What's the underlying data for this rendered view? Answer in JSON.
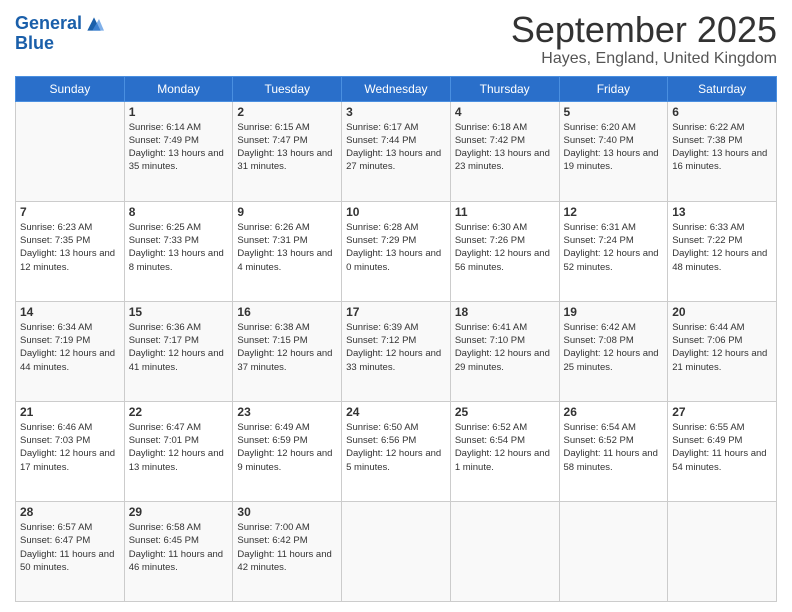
{
  "header": {
    "logo_line1": "General",
    "logo_line2": "Blue",
    "month_title": "September 2025",
    "location": "Hayes, England, United Kingdom"
  },
  "weekdays": [
    "Sunday",
    "Monday",
    "Tuesday",
    "Wednesday",
    "Thursday",
    "Friday",
    "Saturday"
  ],
  "weeks": [
    [
      {
        "day": "",
        "sunrise": "",
        "sunset": "",
        "daylight": ""
      },
      {
        "day": "1",
        "sunrise": "Sunrise: 6:14 AM",
        "sunset": "Sunset: 7:49 PM",
        "daylight": "Daylight: 13 hours and 35 minutes."
      },
      {
        "day": "2",
        "sunrise": "Sunrise: 6:15 AM",
        "sunset": "Sunset: 7:47 PM",
        "daylight": "Daylight: 13 hours and 31 minutes."
      },
      {
        "day": "3",
        "sunrise": "Sunrise: 6:17 AM",
        "sunset": "Sunset: 7:44 PM",
        "daylight": "Daylight: 13 hours and 27 minutes."
      },
      {
        "day": "4",
        "sunrise": "Sunrise: 6:18 AM",
        "sunset": "Sunset: 7:42 PM",
        "daylight": "Daylight: 13 hours and 23 minutes."
      },
      {
        "day": "5",
        "sunrise": "Sunrise: 6:20 AM",
        "sunset": "Sunset: 7:40 PM",
        "daylight": "Daylight: 13 hours and 19 minutes."
      },
      {
        "day": "6",
        "sunrise": "Sunrise: 6:22 AM",
        "sunset": "Sunset: 7:38 PM",
        "daylight": "Daylight: 13 hours and 16 minutes."
      }
    ],
    [
      {
        "day": "7",
        "sunrise": "Sunrise: 6:23 AM",
        "sunset": "Sunset: 7:35 PM",
        "daylight": "Daylight: 13 hours and 12 minutes."
      },
      {
        "day": "8",
        "sunrise": "Sunrise: 6:25 AM",
        "sunset": "Sunset: 7:33 PM",
        "daylight": "Daylight: 13 hours and 8 minutes."
      },
      {
        "day": "9",
        "sunrise": "Sunrise: 6:26 AM",
        "sunset": "Sunset: 7:31 PM",
        "daylight": "Daylight: 13 hours and 4 minutes."
      },
      {
        "day": "10",
        "sunrise": "Sunrise: 6:28 AM",
        "sunset": "Sunset: 7:29 PM",
        "daylight": "Daylight: 13 hours and 0 minutes."
      },
      {
        "day": "11",
        "sunrise": "Sunrise: 6:30 AM",
        "sunset": "Sunset: 7:26 PM",
        "daylight": "Daylight: 12 hours and 56 minutes."
      },
      {
        "day": "12",
        "sunrise": "Sunrise: 6:31 AM",
        "sunset": "Sunset: 7:24 PM",
        "daylight": "Daylight: 12 hours and 52 minutes."
      },
      {
        "day": "13",
        "sunrise": "Sunrise: 6:33 AM",
        "sunset": "Sunset: 7:22 PM",
        "daylight": "Daylight: 12 hours and 48 minutes."
      }
    ],
    [
      {
        "day": "14",
        "sunrise": "Sunrise: 6:34 AM",
        "sunset": "Sunset: 7:19 PM",
        "daylight": "Daylight: 12 hours and 44 minutes."
      },
      {
        "day": "15",
        "sunrise": "Sunrise: 6:36 AM",
        "sunset": "Sunset: 7:17 PM",
        "daylight": "Daylight: 12 hours and 41 minutes."
      },
      {
        "day": "16",
        "sunrise": "Sunrise: 6:38 AM",
        "sunset": "Sunset: 7:15 PM",
        "daylight": "Daylight: 12 hours and 37 minutes."
      },
      {
        "day": "17",
        "sunrise": "Sunrise: 6:39 AM",
        "sunset": "Sunset: 7:12 PM",
        "daylight": "Daylight: 12 hours and 33 minutes."
      },
      {
        "day": "18",
        "sunrise": "Sunrise: 6:41 AM",
        "sunset": "Sunset: 7:10 PM",
        "daylight": "Daylight: 12 hours and 29 minutes."
      },
      {
        "day": "19",
        "sunrise": "Sunrise: 6:42 AM",
        "sunset": "Sunset: 7:08 PM",
        "daylight": "Daylight: 12 hours and 25 minutes."
      },
      {
        "day": "20",
        "sunrise": "Sunrise: 6:44 AM",
        "sunset": "Sunset: 7:06 PM",
        "daylight": "Daylight: 12 hours and 21 minutes."
      }
    ],
    [
      {
        "day": "21",
        "sunrise": "Sunrise: 6:46 AM",
        "sunset": "Sunset: 7:03 PM",
        "daylight": "Daylight: 12 hours and 17 minutes."
      },
      {
        "day": "22",
        "sunrise": "Sunrise: 6:47 AM",
        "sunset": "Sunset: 7:01 PM",
        "daylight": "Daylight: 12 hours and 13 minutes."
      },
      {
        "day": "23",
        "sunrise": "Sunrise: 6:49 AM",
        "sunset": "Sunset: 6:59 PM",
        "daylight": "Daylight: 12 hours and 9 minutes."
      },
      {
        "day": "24",
        "sunrise": "Sunrise: 6:50 AM",
        "sunset": "Sunset: 6:56 PM",
        "daylight": "Daylight: 12 hours and 5 minutes."
      },
      {
        "day": "25",
        "sunrise": "Sunrise: 6:52 AM",
        "sunset": "Sunset: 6:54 PM",
        "daylight": "Daylight: 12 hours and 1 minute."
      },
      {
        "day": "26",
        "sunrise": "Sunrise: 6:54 AM",
        "sunset": "Sunset: 6:52 PM",
        "daylight": "Daylight: 11 hours and 58 minutes."
      },
      {
        "day": "27",
        "sunrise": "Sunrise: 6:55 AM",
        "sunset": "Sunset: 6:49 PM",
        "daylight": "Daylight: 11 hours and 54 minutes."
      }
    ],
    [
      {
        "day": "28",
        "sunrise": "Sunrise: 6:57 AM",
        "sunset": "Sunset: 6:47 PM",
        "daylight": "Daylight: 11 hours and 50 minutes."
      },
      {
        "day": "29",
        "sunrise": "Sunrise: 6:58 AM",
        "sunset": "Sunset: 6:45 PM",
        "daylight": "Daylight: 11 hours and 46 minutes."
      },
      {
        "day": "30",
        "sunrise": "Sunrise: 7:00 AM",
        "sunset": "Sunset: 6:42 PM",
        "daylight": "Daylight: 11 hours and 42 minutes."
      },
      {
        "day": "",
        "sunrise": "",
        "sunset": "",
        "daylight": ""
      },
      {
        "day": "",
        "sunrise": "",
        "sunset": "",
        "daylight": ""
      },
      {
        "day": "",
        "sunrise": "",
        "sunset": "",
        "daylight": ""
      },
      {
        "day": "",
        "sunrise": "",
        "sunset": "",
        "daylight": ""
      }
    ]
  ]
}
